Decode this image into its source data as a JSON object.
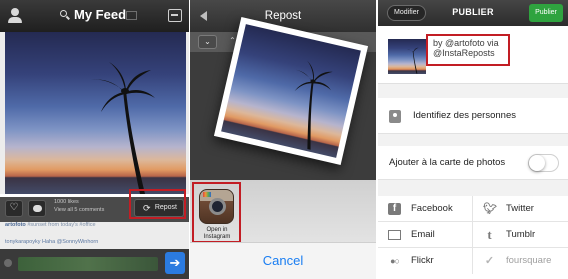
{
  "feed_screen": {
    "title": "My Feed",
    "likes": "1000 likes",
    "comments": "View all 5 comments",
    "repost_label": "Repost",
    "caption_user": "artofoto",
    "caption_text": "#sunset from today's #office",
    "caption2": "tonykarapoyky Haha @SonnyWinhorn"
  },
  "repost_screen": {
    "title": "Repost",
    "chevron_down": "⌄",
    "chevron_up": "⌃",
    "open_in_label": "Open in Instagram",
    "cancel_label": "Cancel"
  },
  "publish_screen": {
    "modifier_label": "Modifier",
    "title": "PUBLIER",
    "publier_button": "Publier",
    "caption_line1": "by @artofoto via",
    "caption_line2": "@InstaReposts",
    "tag_people": "Identifiez des personnes",
    "add_to_map": "Ajouter à la carte de photos",
    "share_options": [
      {
        "label": "Facebook",
        "icon": "f"
      },
      {
        "label": "Twitter",
        "icon": "twitter-bird"
      },
      {
        "label": "Email",
        "icon": "envelope"
      },
      {
        "label": "Tumblr",
        "icon": "t"
      },
      {
        "label": "Flickr",
        "icon": "flickr-dots"
      },
      {
        "label": "foursquare",
        "icon": "foursquare-f"
      }
    ]
  },
  "colors": {
    "highlight_red": "#c21d24",
    "ios_blue": "#1a7ef2",
    "publier_green": "#2fa33f"
  }
}
